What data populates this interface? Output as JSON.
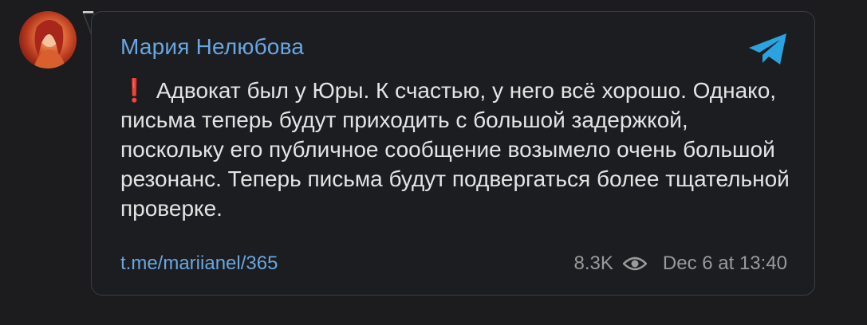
{
  "post": {
    "author": "Мария Нелюбова",
    "alert_mark": "❗",
    "text": "Адвокат был у Юры. К счастью, у него всё хорошо. Однако, письма теперь будут приходить с большой задержкой, поскольку его публичное сообщение возымело очень большой резонанс. Теперь письма будут подвергаться более тщательной проверке.",
    "link": "t.me/mariianel/365",
    "views": "8.3K",
    "timestamp": "Dec 6 at 13:40"
  },
  "icons": {
    "brand": "telegram-icon",
    "views": "eye-icon",
    "alert": "exclamation-icon"
  },
  "colors": {
    "background": "#1c1c1e",
    "author": "#6aa6e0",
    "link": "#6aa6e0",
    "telegram": "#2aa3e0",
    "alert": "#e0262e",
    "text": "#e4e4e4",
    "meta": "#9a9a9a"
  }
}
